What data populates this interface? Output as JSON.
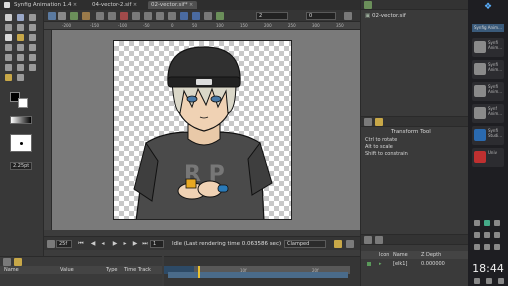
{
  "tabs": {
    "app_title": "Synfig Animation 1.4",
    "tab1": "04-vector-2.sif",
    "tab2": "02-vector.sif*"
  },
  "toolbar": {
    "spin1_value": "2",
    "spin2_value": "0"
  },
  "hruler": [
    "-200",
    "-150",
    "-100",
    "-50",
    "0",
    "50",
    "100",
    "150",
    "200",
    "250",
    "300",
    "350"
  ],
  "toolbox": {
    "brush_size": "2.25pt"
  },
  "timebar": {
    "time": "25f",
    "status": "Idle (Last rendering time 0.063586 sec)",
    "interpolation": "Clamped",
    "end_time": "1"
  },
  "params": {
    "col_name": "Name",
    "col_value": "Value",
    "col_type": "Type",
    "col_timetrack": "Time Track"
  },
  "timetrack": {
    "mark1": "10f",
    "mark2": "20f"
  },
  "canvas_browser": {
    "item": "02-vector.sif"
  },
  "tool_options": {
    "title": "Transform Tool",
    "hint1": "Ctrl to rotate",
    "hint2": "Alt to scale",
    "hint3": "Shift to constrain"
  },
  "layers": {
    "col_icon": "Icon",
    "col_name": "Name",
    "col_zdepth": "Z Depth",
    "row_name": "[elk1]",
    "row_zdepth": "0.000000"
  },
  "dock": {
    "header": "Synfig Anim...",
    "items": [
      "Synfi Anim...",
      "Synfi Anim...",
      "Synfi Anim...",
      "Synf Anim...",
      "Synfi Studi...",
      "Univ"
    ],
    "clock": "18:44"
  },
  "colors": {
    "accent": "#4a6b8a",
    "canvas_bg": "#7a7a7a",
    "checker": "#c8c8c8"
  }
}
